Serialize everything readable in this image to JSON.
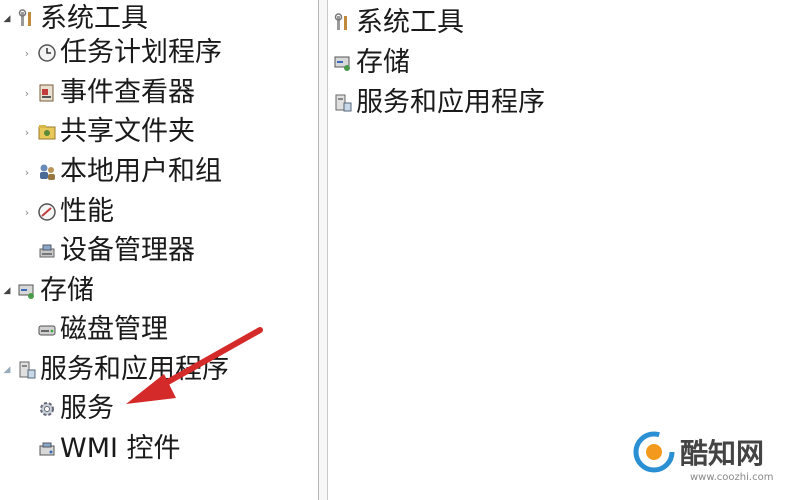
{
  "tree": {
    "system_tools": "系统工具",
    "task_scheduler": "任务计划程序",
    "event_viewer": "事件查看器",
    "shared_folders": "共享文件夹",
    "local_users_groups": "本地用户和组",
    "performance": "性能",
    "device_manager": "设备管理器",
    "storage": "存储",
    "disk_management": "磁盘管理",
    "services_apps": "服务和应用程序",
    "services": "服务",
    "wmi_control": "WMI 控件"
  },
  "right": {
    "items": [
      "系统工具",
      "存储",
      "服务和应用程序"
    ]
  },
  "watermark": {
    "name": "酷知网",
    "url": "www.coozhi.com"
  },
  "colors": {
    "arrow": "#d42a2a",
    "watermark_accent": "#f39a1e",
    "watermark_blue": "#2b8fd4"
  }
}
